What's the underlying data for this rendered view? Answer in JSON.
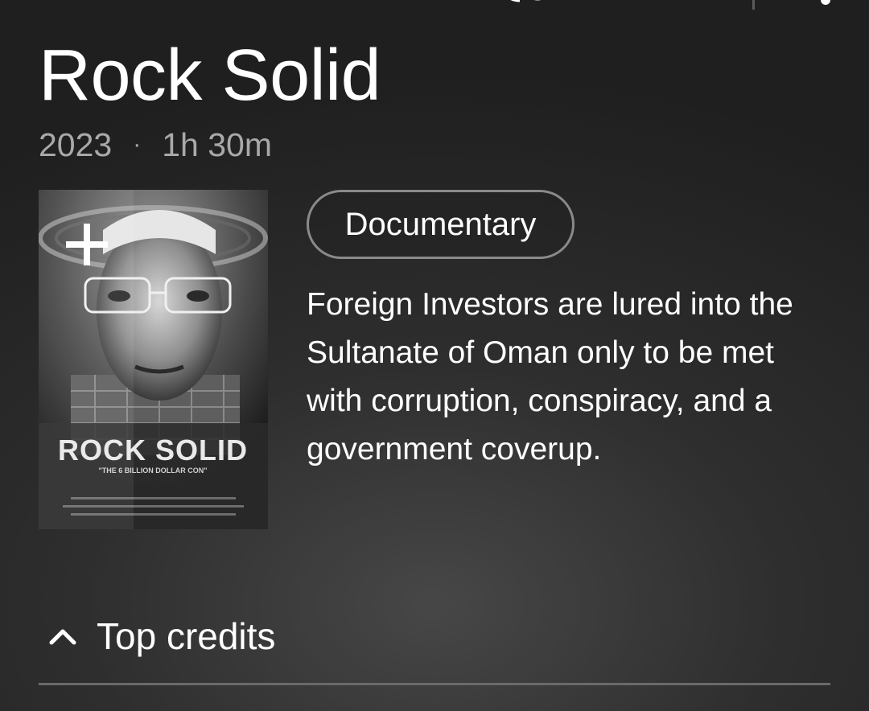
{
  "header": {
    "top_icons": [
      "cast-icon",
      "more-vert-icon"
    ]
  },
  "movie": {
    "title": "Rock Solid",
    "year": "2023",
    "separator": "·",
    "duration": "1h 30m",
    "genre": "Documentary",
    "description": "Foreign Investors are lured into the Sultanate of Oman only to be met with corruption, conspiracy, and a government coverup."
  },
  "poster": {
    "title_art": "ROCK SOLID",
    "tagline": "\"THE 6 BILLION DOLLAR CON\"",
    "add_icon": "plus-icon"
  },
  "credits": {
    "label": "Top credits",
    "expanded": true,
    "icon": "chevron-up-icon"
  }
}
